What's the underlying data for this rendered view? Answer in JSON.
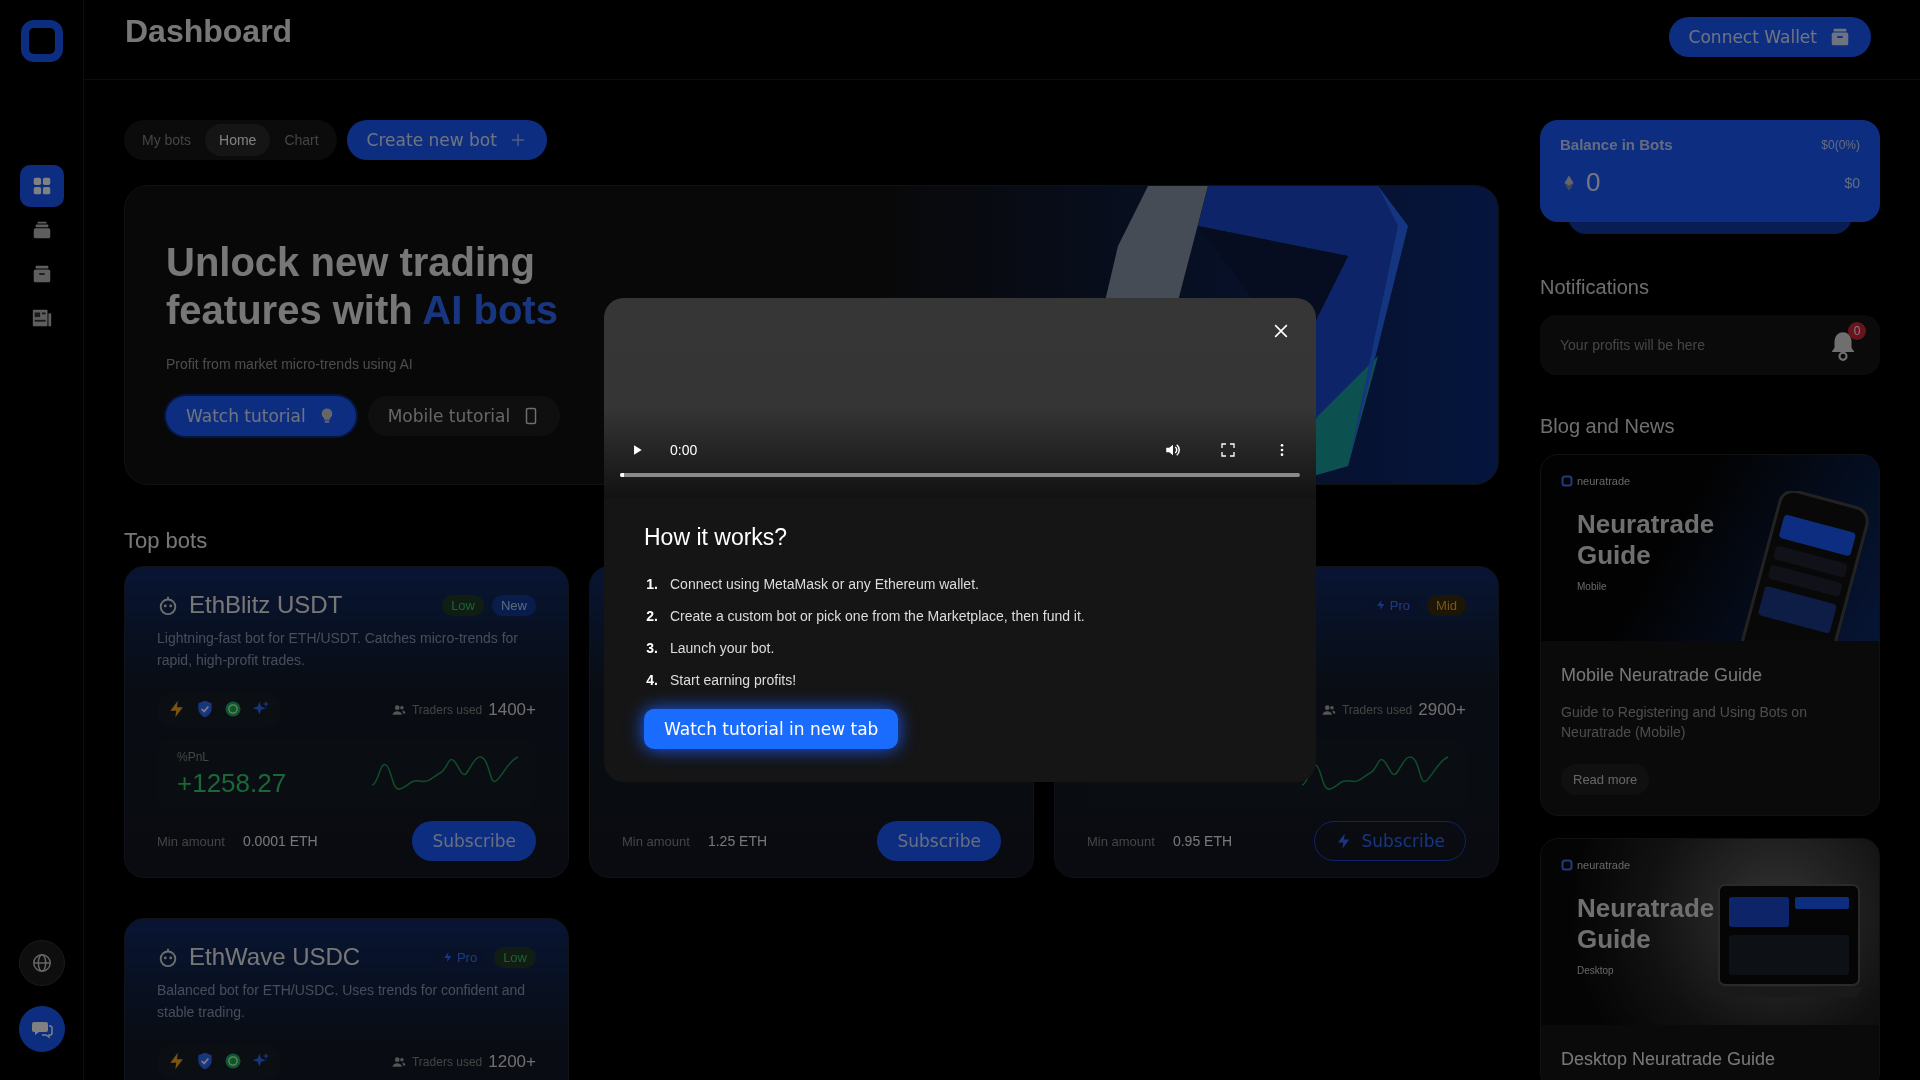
{
  "sidebar": {
    "items": [
      {
        "selected": true
      },
      {
        "selected": false
      },
      {
        "selected": false
      },
      {
        "selected": false
      }
    ]
  },
  "header": {
    "title": "Dashboard",
    "connect_button": "Connect Wallet"
  },
  "tabs": [
    {
      "label": "My bots",
      "selected": false
    },
    {
      "label": "Home",
      "selected": true
    },
    {
      "label": "Chart",
      "selected": false
    }
  ],
  "create_button": "Create new bot",
  "hero": {
    "title": "Unlock new trading features with",
    "title_highlight": "AI bots",
    "subtitle": "Profit from market micro-trends using AI",
    "buttons": [
      {
        "label": "Watch tutorial",
        "kind": "primary"
      },
      {
        "label": "Mobile tutorial",
        "kind": "secondary"
      }
    ]
  },
  "top_bots": {
    "heading": "Top bots",
    "bots": [
      {
        "name": "EthBlitz USDT",
        "tags": [
          {
            "label": "Low",
            "kind": "low"
          },
          {
            "label": "New",
            "kind": "new"
          }
        ],
        "description": "Lightning-fast bot for ETH/USDT. Catches micro-trends for rapid, high-profit trades.",
        "traders_label": "Traders used",
        "traders": "1400+",
        "pnl_label": "%PnL",
        "pnl": "+1258.27",
        "min_label": "Min amount",
        "min_amount": "0.0001 ETH",
        "subscribe": {
          "label": "Subscribe",
          "kind": "filled"
        }
      },
      {
        "min_label": "Min amount",
        "min_amount": "1.25 ETH",
        "subscribe": {
          "label": "Subscribe",
          "kind": "filled"
        }
      },
      {
        "tags": [
          {
            "label": "Pro",
            "kind": "pro"
          },
          {
            "label": "Mid",
            "kind": "mid"
          }
        ],
        "traders_label": "Traders used",
        "traders": "2900+",
        "min_label": "Min amount",
        "min_amount": "0.95 ETH",
        "subscribe": {
          "label": "Subscribe",
          "kind": "outline"
        }
      },
      {
        "name": "EthWave USDC",
        "tags": [
          {
            "label": "Pro",
            "kind": "pro"
          },
          {
            "label": "Low",
            "kind": "low"
          }
        ],
        "description": "Balanced bot for ETH/USDC. Uses trends for confident and stable trading.",
        "traders_label": "Traders used",
        "traders": "1200+"
      }
    ]
  },
  "balance": {
    "title": "Balance in Bots",
    "change": "$0(0%)",
    "amount": "0",
    "usd": "$0"
  },
  "notifications": {
    "heading": "Notifications",
    "placeholder": "Your profits will be here",
    "badge": "0"
  },
  "blog": {
    "heading": "Blog and News",
    "posts": [
      {
        "brand": "neuratrade",
        "image_title": "Neuratrade Guide",
        "image_sub": "Mobile",
        "kind": "mobile",
        "title": "Mobile Neuratrade Guide",
        "description": "Guide to Registering and Using Bots on Neuratrade (Mobile)",
        "button": "Read more"
      },
      {
        "brand": "neuratrade",
        "image_title": "Neuratrade Guide",
        "image_sub": "Desktop",
        "kind": "desktop",
        "title": "Desktop Neuratrade Guide"
      }
    ]
  },
  "modal": {
    "time": "0:00",
    "progress": {
      "level": 0
    },
    "heading": "How it works?",
    "steps": [
      {
        "number": "1.",
        "text": "Connect using MetaMask or any Ethereum wallet."
      },
      {
        "number": "2.",
        "text": "Create a custom bot or pick one from the Marketplace, then fund it."
      },
      {
        "number": "3.",
        "text": "Launch your bot."
      },
      {
        "number": "4.",
        "text": "Start earning profits!"
      }
    ],
    "button": "Watch tutorial in new tab"
  }
}
